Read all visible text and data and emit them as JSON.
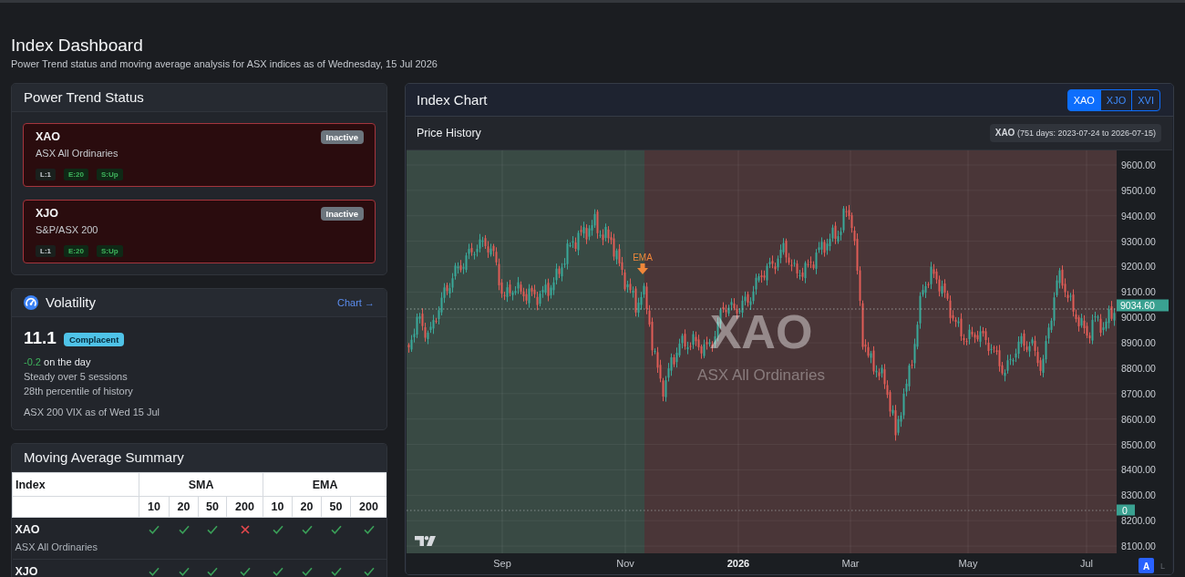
{
  "header": {
    "title": "Index Dashboard",
    "subtitle": "Power Trend status and moving average analysis for ASX indices as of Wednesday, 15 Jul 2026"
  },
  "power_trend": {
    "title": "Power Trend Status",
    "items": [
      {
        "symbol": "XAO",
        "name": "ASX All Ordinaries",
        "status": "Inactive",
        "active": false,
        "chips": [
          {
            "label": "L:1",
            "kind": "neutral"
          },
          {
            "label": "E:20",
            "kind": "positive"
          },
          {
            "label": "S:Up",
            "kind": "positive"
          }
        ]
      },
      {
        "symbol": "XJO",
        "name": "S&P/ASX 200",
        "status": "Inactive",
        "active": false,
        "chips": [
          {
            "label": "L:1",
            "kind": "neutral"
          },
          {
            "label": "E:20",
            "kind": "positive"
          },
          {
            "label": "S:Up",
            "kind": "positive"
          }
        ]
      }
    ]
  },
  "volatility": {
    "title": "Volatility",
    "link": "Chart →",
    "value": "11.1",
    "badge": "Complacent",
    "change": "-0.2",
    "change_good": true,
    "change_text": "on the day",
    "lines": [
      "Steady over 5 sessions",
      "28th percentile of history"
    ],
    "footnote": "ASX 200 VIX as of Wed 15 Jul"
  },
  "ma_summary": {
    "title": "Moving Average Summary",
    "index_header": "Index",
    "groups": [
      {
        "label": "SMA",
        "periods": [
          "10",
          "20",
          "50",
          "200"
        ]
      },
      {
        "label": "EMA",
        "periods": [
          "10",
          "20",
          "50",
          "200"
        ]
      }
    ],
    "rows": [
      {
        "symbol": "XAO",
        "name": "ASX All Ordinaries",
        "above": [
          true,
          true,
          true,
          false,
          true,
          true,
          true,
          true
        ]
      },
      {
        "symbol": "XJO",
        "above": [
          true,
          true,
          true,
          true,
          true,
          true,
          true,
          true
        ]
      }
    ]
  },
  "index_chart": {
    "title": "Index Chart",
    "symbols": [
      {
        "label": "XAO",
        "selected": true
      },
      {
        "label": "XJO",
        "selected": false
      },
      {
        "label": "XVI",
        "selected": false
      }
    ],
    "panel_title": "Price History",
    "range_badge": "**XAO** (751 days: 2023-07-24 to 2026-07-15)",
    "watermark_symbol": "XAO",
    "watermark_name": "ASX All Ordinaries",
    "marker": "EMA",
    "price_axis": [
      "9600.00",
      "9500.00",
      "9400.00",
      "9300.00",
      "9200.00",
      "9100.00",
      "9000.00",
      "8900.00",
      "8800.00",
      "8700.00",
      "8600.00",
      "8500.00",
      "8400.00",
      "8300.00",
      "8200.00",
      "8100.00"
    ],
    "last_price": "9034.60",
    "price_line_label": "0",
    "time_axis": [
      {
        "label": "Sep",
        "kind": "month"
      },
      {
        "label": "Nov",
        "kind": "month"
      },
      {
        "label": "2026",
        "kind": "year"
      },
      {
        "label": "Mar",
        "kind": "month"
      },
      {
        "label": "May",
        "kind": "month"
      },
      {
        "label": "Jul",
        "kind": "month"
      }
    ],
    "scale_buttons": [
      {
        "label": "A",
        "selected": true
      },
      {
        "label": "L",
        "selected": false
      }
    ]
  }
}
